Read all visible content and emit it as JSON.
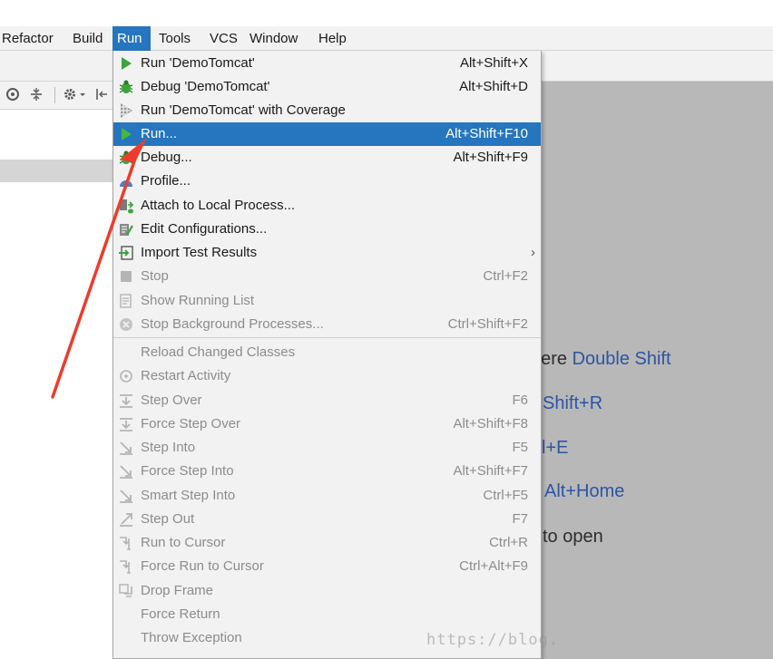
{
  "menubar": {
    "items": [
      {
        "label": "Refactor"
      },
      {
        "label": "Build"
      },
      {
        "label": "Run"
      },
      {
        "label": "Tools"
      },
      {
        "label": "VCS"
      },
      {
        "label": "Window"
      },
      {
        "label": "Help"
      }
    ]
  },
  "run_menu": {
    "items": [
      {
        "label": "Run 'DemoTomcat'",
        "shortcut": "Alt+Shift+X",
        "icon": "play-icon"
      },
      {
        "label": "Debug 'DemoTomcat'",
        "shortcut": "Alt+Shift+D",
        "icon": "bug-icon"
      },
      {
        "label": "Run 'DemoTomcat' with Coverage",
        "shortcut": "",
        "icon": "coverage-icon"
      },
      {
        "label": "Run...",
        "shortcut": "Alt+Shift+F10",
        "icon": "play-icon"
      },
      {
        "label": "Debug...",
        "shortcut": "Alt+Shift+F9",
        "icon": "bug-icon"
      },
      {
        "label": "Profile...",
        "shortcut": "",
        "icon": "profile-icon"
      },
      {
        "label": "Attach to Local Process...",
        "shortcut": "",
        "icon": "attach-icon"
      },
      {
        "label": "Edit Configurations...",
        "shortcut": "",
        "icon": "edit-config-icon"
      },
      {
        "label": "Import Test Results",
        "shortcut": "",
        "icon": "import-icon",
        "submenu": "›"
      },
      {
        "label": "Stop",
        "shortcut": "Ctrl+F2",
        "icon": "stop-icon"
      },
      {
        "label": "Show Running List",
        "shortcut": "",
        "icon": "list-icon"
      },
      {
        "label": "Stop Background Processes...",
        "shortcut": "Ctrl+Shift+F2",
        "icon": "stop-circle-icon"
      },
      {
        "label": "Reload Changed Classes",
        "shortcut": "",
        "icon": ""
      },
      {
        "label": "Restart Activity",
        "shortcut": "",
        "icon": "restart-icon"
      },
      {
        "label": "Step Over",
        "shortcut": "F6",
        "icon": "step-over-icon"
      },
      {
        "label": "Force Step Over",
        "shortcut": "Alt+Shift+F8",
        "icon": "force-step-over-icon"
      },
      {
        "label": "Step Into",
        "shortcut": "F5",
        "icon": "step-into-icon"
      },
      {
        "label": "Force Step Into",
        "shortcut": "Alt+Shift+F7",
        "icon": "force-step-into-icon"
      },
      {
        "label": "Smart Step Into",
        "shortcut": "Ctrl+F5",
        "icon": "smart-step-into-icon"
      },
      {
        "label": "Step Out",
        "shortcut": "F7",
        "icon": "step-out-icon"
      },
      {
        "label": "Run to Cursor",
        "shortcut": "Ctrl+R",
        "icon": "run-to-cursor-icon"
      },
      {
        "label": "Force Run to Cursor",
        "shortcut": "Ctrl+Alt+F9",
        "icon": "force-run-to-cursor-icon"
      },
      {
        "label": "Drop Frame",
        "shortcut": "",
        "icon": "drop-frame-icon"
      },
      {
        "label": "Force Return",
        "shortcut": "",
        "icon": ""
      },
      {
        "label": "Throw Exception",
        "shortcut": "",
        "icon": ""
      }
    ]
  },
  "editor_hints": [
    {
      "text": "here",
      "key": "Double Shift"
    },
    {
      "text": "",
      "key": "Shift+R"
    },
    {
      "text": "",
      "key": "l+E"
    },
    {
      "text": "",
      "key": "Alt+Home"
    },
    {
      "text": "to open",
      "key": ""
    }
  ],
  "watermark": "https://blog.",
  "colors": {
    "accent": "#2675bf",
    "run_green": "#3aa63a",
    "hint_key": "#2b55a6",
    "annotation_arrow": "#ef3b2c"
  }
}
